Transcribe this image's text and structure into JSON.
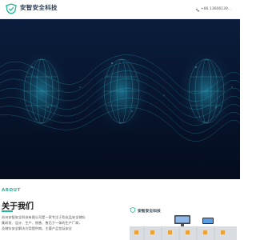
{
  "header": {
    "brand": "安智安全科技",
    "tagline": "",
    "phone": "+86 13606139...",
    "logo_icon": "shield-check-icon",
    "phone_icon": "phone-icon"
  },
  "banner": {
    "background": "#06122a",
    "accent": "#3fd6e6"
  },
  "about": {
    "label": "ABOUT",
    "title": "关于我们",
    "paragraphs": [
      "苏州安智安全科技有限公司是一家专注于危化品安全储存",
      "集研发、设计、生产、销售、售后于一体的生产厂商，",
      "及储存安全解决方案提供商。主要产品包括安全"
    ]
  },
  "product": {
    "brand": "安智安全科技"
  },
  "colors": {
    "accent": "#1fb89a",
    "heading": "#111111"
  }
}
